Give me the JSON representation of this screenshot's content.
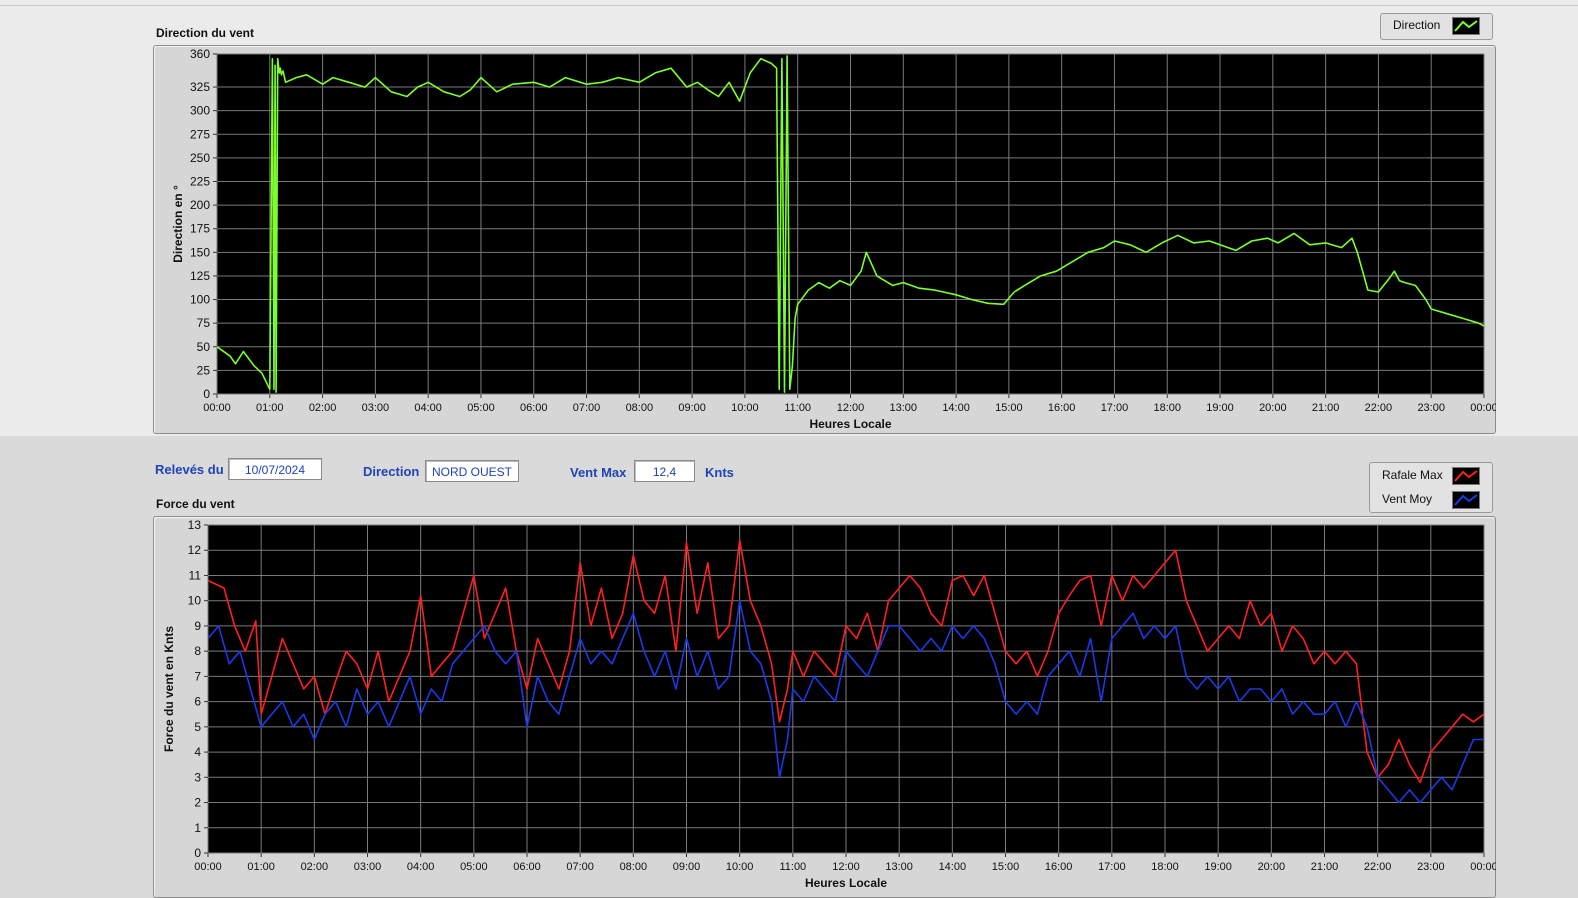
{
  "colors": {
    "direction": "#7cff2c",
    "rafale": "#ff1f1f",
    "vent_moy": "#1a3ae6",
    "label_blue": "#1f43b8"
  },
  "info": {
    "releves_label": "Relevés du",
    "releves_value": "10/07/2024",
    "direction_label": "Direction",
    "direction_value": "NORD OUEST",
    "ventmax_label": "Vent Max",
    "ventmax_value": "12,4",
    "ventmax_unit": "Knts"
  },
  "legend_top": [
    "Direction"
  ],
  "legend_bottom": [
    "Rafale Max",
    "Vent Moy"
  ],
  "chart_data": [
    {
      "type": "line",
      "title": "Direction du vent",
      "xlabel": "Heures Locale",
      "ylabel": "Direction en °",
      "xlim": [
        0,
        24
      ],
      "ylim": [
        0,
        360
      ],
      "yticks": [
        0,
        25,
        50,
        75,
        100,
        125,
        150,
        175,
        200,
        225,
        250,
        275,
        300,
        325,
        360
      ],
      "xticks": [
        "00:00",
        "01:00",
        "02:00",
        "03:00",
        "04:00",
        "05:00",
        "06:00",
        "07:00",
        "08:00",
        "09:00",
        "10:00",
        "11:00",
        "12:00",
        "13:00",
        "14:00",
        "15:00",
        "16:00",
        "17:00",
        "18:00",
        "19:00",
        "20:00",
        "21:00",
        "22:00",
        "23:00",
        "00:00"
      ],
      "grid": true,
      "legend": "top-right",
      "series": [
        {
          "name": "Direction",
          "color": "#7cff2c",
          "x": [
            0,
            0.25,
            0.35,
            0.5,
            0.7,
            0.85,
            1.0,
            1.05,
            1.08,
            1.1,
            1.12,
            1.15,
            1.18,
            1.2,
            1.22,
            1.25,
            1.3,
            1.5,
            1.7,
            2.0,
            2.2,
            2.5,
            2.8,
            3.0,
            3.3,
            3.6,
            3.8,
            4.0,
            4.3,
            4.6,
            4.8,
            5.0,
            5.3,
            5.6,
            6.0,
            6.3,
            6.6,
            7.0,
            7.3,
            7.6,
            8.0,
            8.3,
            8.6,
            8.9,
            9.1,
            9.3,
            9.5,
            9.7,
            9.9,
            10.1,
            10.3,
            10.5,
            10.6,
            10.65,
            10.7,
            10.75,
            10.8,
            10.85,
            10.9,
            10.95,
            11.0,
            11.2,
            11.4,
            11.6,
            11.8,
            12.0,
            12.2,
            12.3,
            12.5,
            12.8,
            13.0,
            13.3,
            13.6,
            14.0,
            14.3,
            14.6,
            14.9,
            15.1,
            15.3,
            15.6,
            15.9,
            16.2,
            16.5,
            16.8,
            17.0,
            17.3,
            17.6,
            17.9,
            18.2,
            18.5,
            18.8,
            19.0,
            19.3,
            19.6,
            19.9,
            20.1,
            20.4,
            20.7,
            21.0,
            21.3,
            21.5,
            21.6,
            21.7,
            21.8,
            22.0,
            22.2,
            22.3,
            22.4,
            22.5,
            22.7,
            22.9,
            23.0,
            23.3,
            23.6,
            23.9,
            24.0
          ],
          "y": [
            50,
            40,
            32,
            45,
            30,
            22,
            5,
            355,
            5,
            348,
            2,
            355,
            340,
            345,
            338,
            342,
            330,
            335,
            338,
            328,
            335,
            330,
            325,
            335,
            320,
            315,
            325,
            330,
            320,
            315,
            322,
            335,
            320,
            328,
            330,
            325,
            335,
            328,
            330,
            335,
            330,
            340,
            345,
            325,
            330,
            322,
            315,
            330,
            310,
            340,
            355,
            350,
            345,
            5,
            355,
            2,
            358,
            5,
            30,
            80,
            95,
            110,
            118,
            112,
            120,
            115,
            130,
            150,
            125,
            115,
            118,
            112,
            110,
            105,
            100,
            96,
            95,
            108,
            115,
            125,
            130,
            140,
            150,
            155,
            162,
            158,
            150,
            160,
            168,
            160,
            162,
            158,
            152,
            162,
            165,
            160,
            170,
            158,
            160,
            155,
            165,
            150,
            130,
            110,
            108,
            122,
            130,
            120,
            118,
            115,
            100,
            90,
            85,
            80,
            75,
            72
          ]
        }
      ]
    },
    {
      "type": "line",
      "title": "Force du vent",
      "xlabel": "Heures Locale",
      "ylabel": "Force du vent en Knts",
      "xlim": [
        0,
        24
      ],
      "ylim": [
        0,
        13
      ],
      "yticks": [
        0,
        1,
        2,
        3,
        4,
        5,
        6,
        7,
        8,
        9,
        10,
        11,
        12,
        13
      ],
      "xticks": [
        "00:00",
        "01:00",
        "02:00",
        "03:00",
        "04:00",
        "05:00",
        "06:00",
        "07:00",
        "08:00",
        "09:00",
        "10:00",
        "11:00",
        "12:00",
        "13:00",
        "14:00",
        "15:00",
        "16:00",
        "17:00",
        "18:00",
        "19:00",
        "20:00",
        "21:00",
        "22:00",
        "23:00",
        "00:00"
      ],
      "grid": true,
      "legend": "top-right",
      "series": [
        {
          "name": "Rafale Max",
          "color": "#ff1f1f",
          "x": [
            0,
            0.3,
            0.5,
            0.7,
            0.9,
            1.0,
            1.2,
            1.4,
            1.6,
            1.8,
            2.0,
            2.2,
            2.4,
            2.6,
            2.8,
            3.0,
            3.2,
            3.4,
            3.6,
            3.8,
            4.0,
            4.2,
            4.4,
            4.6,
            4.8,
            5.0,
            5.2,
            5.4,
            5.6,
            5.8,
            6.0,
            6.2,
            6.4,
            6.6,
            6.8,
            7.0,
            7.2,
            7.4,
            7.6,
            7.8,
            8.0,
            8.2,
            8.4,
            8.6,
            8.8,
            9.0,
            9.2,
            9.4,
            9.6,
            9.8,
            10.0,
            10.2,
            10.4,
            10.6,
            10.75,
            10.9,
            11.0,
            11.2,
            11.4,
            11.6,
            11.8,
            12.0,
            12.2,
            12.4,
            12.6,
            12.8,
            13.0,
            13.2,
            13.4,
            13.6,
            13.8,
            14.0,
            14.2,
            14.4,
            14.6,
            14.8,
            15.0,
            15.2,
            15.4,
            15.6,
            15.8,
            16.0,
            16.2,
            16.4,
            16.6,
            16.8,
            17.0,
            17.2,
            17.4,
            17.6,
            17.8,
            18.0,
            18.2,
            18.4,
            18.6,
            18.8,
            19.0,
            19.2,
            19.4,
            19.6,
            19.8,
            20.0,
            20.2,
            20.4,
            20.6,
            20.8,
            21.0,
            21.2,
            21.4,
            21.6,
            21.8,
            22.0,
            22.2,
            22.4,
            22.6,
            22.8,
            23.0,
            23.2,
            23.4,
            23.6,
            23.8,
            24.0
          ],
          "y": [
            10.8,
            10.5,
            9,
            8,
            9.2,
            5.5,
            7,
            8.5,
            7.5,
            6.5,
            7,
            5.5,
            6.8,
            8,
            7.5,
            6.5,
            8,
            6,
            7,
            8,
            10.2,
            7,
            7.5,
            8,
            9.5,
            11,
            8.5,
            9.5,
            10.5,
            8,
            6.5,
            8.5,
            7.5,
            6.5,
            8,
            11.5,
            9,
            10.5,
            8.5,
            9.5,
            11.8,
            10,
            9.5,
            11,
            8,
            12.3,
            9.5,
            11.5,
            8.5,
            9,
            12.4,
            10,
            9,
            7.5,
            5.2,
            6.5,
            8,
            7,
            8,
            7.5,
            7,
            9,
            8.5,
            9.5,
            8,
            10,
            10.5,
            11,
            10.5,
            9.5,
            9,
            10.8,
            11,
            10.2,
            11,
            9.5,
            8,
            7.5,
            8,
            7,
            8,
            9.5,
            10.2,
            10.8,
            11,
            9,
            11,
            10,
            11,
            10.5,
            11,
            11.5,
            12,
            10,
            9,
            8,
            8.5,
            9,
            8.5,
            10,
            9,
            9.5,
            8,
            9,
            8.5,
            7.5,
            8,
            7.5,
            8,
            7.5,
            4,
            3,
            3.5,
            4.5,
            3.5,
            2.8,
            4,
            4.5,
            5,
            5.5,
            5.2,
            5.5
          ]
        },
        {
          "name": "Vent Moy",
          "color": "#1a3ae6",
          "x": [
            0,
            0.2,
            0.4,
            0.6,
            0.8,
            1.0,
            1.2,
            1.4,
            1.6,
            1.8,
            2.0,
            2.2,
            2.4,
            2.6,
            2.8,
            3.0,
            3.2,
            3.4,
            3.6,
            3.8,
            4.0,
            4.2,
            4.4,
            4.6,
            4.8,
            5.0,
            5.2,
            5.4,
            5.6,
            5.8,
            6.0,
            6.2,
            6.4,
            6.6,
            6.8,
            7.0,
            7.2,
            7.4,
            7.6,
            7.8,
            8.0,
            8.2,
            8.4,
            8.6,
            8.8,
            9.0,
            9.2,
            9.4,
            9.6,
            9.8,
            10.0,
            10.2,
            10.4,
            10.6,
            10.75,
            10.9,
            11.0,
            11.2,
            11.4,
            11.6,
            11.8,
            12.0,
            12.2,
            12.4,
            12.6,
            12.8,
            13.0,
            13.2,
            13.4,
            13.6,
            13.8,
            14.0,
            14.2,
            14.4,
            14.6,
            14.8,
            15.0,
            15.2,
            15.4,
            15.6,
            15.8,
            16.0,
            16.2,
            16.4,
            16.6,
            16.8,
            17.0,
            17.2,
            17.4,
            17.6,
            17.8,
            18.0,
            18.2,
            18.4,
            18.6,
            18.8,
            19.0,
            19.2,
            19.4,
            19.6,
            19.8,
            20.0,
            20.2,
            20.4,
            20.6,
            20.8,
            21.0,
            21.2,
            21.4,
            21.6,
            21.8,
            22.0,
            22.2,
            22.4,
            22.6,
            22.8,
            23.0,
            23.2,
            23.4,
            23.6,
            23.8,
            24.0
          ],
          "y": [
            8.5,
            9,
            7.5,
            8,
            6.5,
            5,
            5.5,
            6,
            5,
            5.5,
            4.5,
            5.5,
            6,
            5,
            6.5,
            5.5,
            6,
            5,
            6,
            7,
            5.5,
            6.5,
            6,
            7.5,
            8,
            8.5,
            9,
            8,
            7.5,
            8,
            5,
            7,
            6,
            5.5,
            7,
            8.5,
            7.5,
            8,
            7.5,
            8.5,
            9.5,
            8,
            7,
            8,
            6.5,
            8.5,
            7,
            8,
            6.5,
            7,
            10,
            8,
            7.5,
            6,
            3,
            4.5,
            6.5,
            6,
            7,
            6.5,
            6,
            8,
            7.5,
            7,
            8,
            9,
            9,
            8.5,
            8,
            8.5,
            8,
            9,
            8.5,
            9,
            8.5,
            7.5,
            6,
            5.5,
            6,
            5.5,
            7,
            7.5,
            8,
            7,
            8.5,
            6,
            8.5,
            9,
            9.5,
            8.5,
            9,
            8.5,
            9,
            7,
            6.5,
            7,
            6.5,
            7,
            6,
            6.5,
            6.5,
            6,
            6.5,
            5.5,
            6,
            5.5,
            5.5,
            6,
            5,
            6,
            5,
            3,
            2.5,
            2,
            2.5,
            2,
            2.5,
            3,
            2.5,
            3.5,
            4.5,
            4.5
          ]
        }
      ]
    }
  ]
}
